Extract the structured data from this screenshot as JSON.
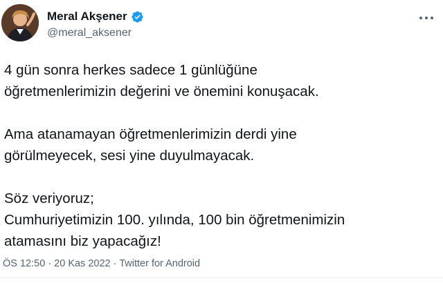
{
  "author": {
    "display_name": "Meral Akşener",
    "handle": "@meral_aksener",
    "verified": true,
    "verified_color": "#1d9bf0",
    "avatar_icon": "profile-photo"
  },
  "more_options_icon": "more-horizontal-icon",
  "tweet": {
    "paragraphs": [
      {
        "lines": [
          "4 gün sonra herkes sadece 1 günlüğüne",
          "öğretmenlerimizin değerini ve önemini konuşacak."
        ]
      },
      {
        "lines": [
          "Ama atanamayan öğretmenlerimizin derdi yine",
          "görülmeyecek, sesi yine duyulmayacak."
        ]
      },
      {
        "lines": [
          "Söz veriyoruz;",
          "Cumhuriyetimizin 100. yılında, 100 bin öğretmenimizin",
          "atamasını biz yapacağız!"
        ]
      }
    ]
  },
  "meta": {
    "time": "ÖS 12:50",
    "separator1": " · ",
    "date": "20 Kas 2022",
    "separator2": " · ",
    "source": "Twitter for Android"
  }
}
